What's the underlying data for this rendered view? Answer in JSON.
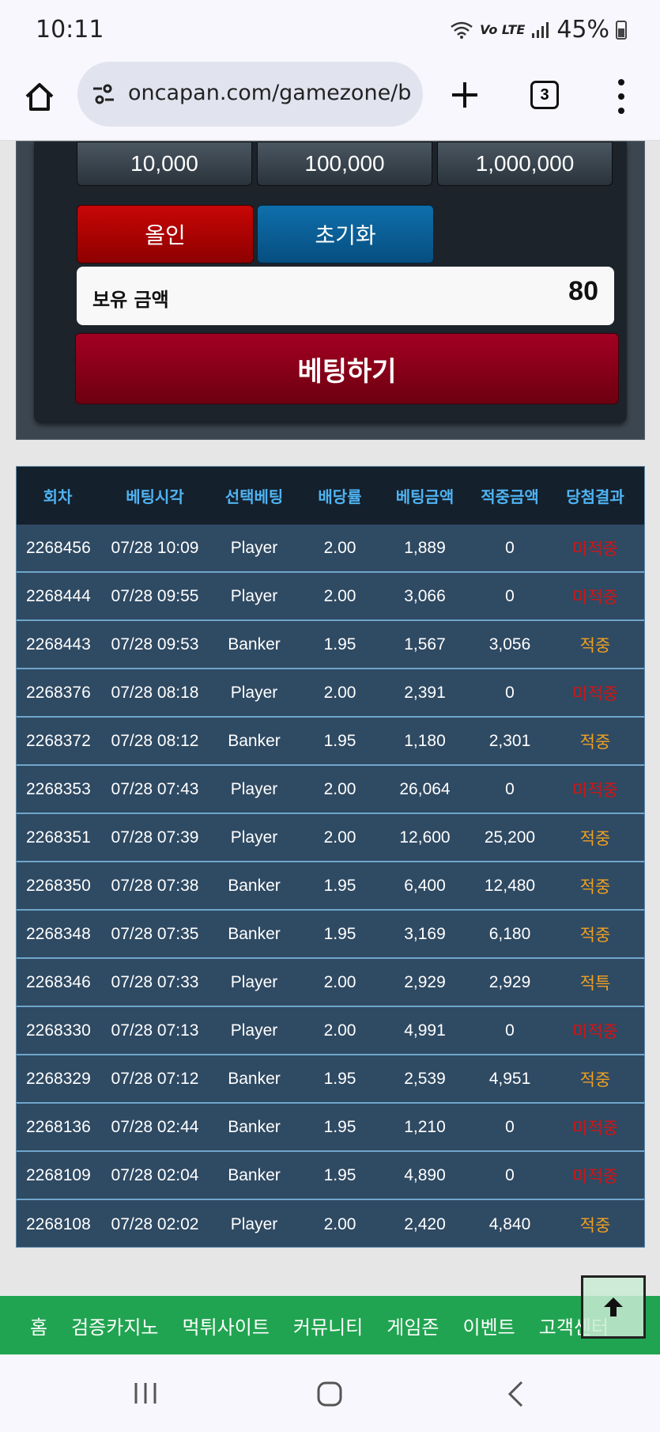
{
  "status_bar": {
    "time": "10:11",
    "network": "Vo LTE",
    "battery": "45%"
  },
  "browser": {
    "url": "oncapan.com/gamezone/b",
    "tab_count": "3"
  },
  "bet_panel": {
    "chips": [
      "10,000",
      "100,000",
      "1,000,000"
    ],
    "all_in_label": "올인",
    "reset_label": "초기화",
    "balance_label": "보유 금액",
    "balance_value": "80",
    "bet_button_label": "베팅하기"
  },
  "history": {
    "headers": [
      "회차",
      "베팅시각",
      "선택베팅",
      "배당률",
      "베팅금액",
      "적중금액",
      "당첨결과"
    ],
    "result_colors": {
      "hit": "#f0a020",
      "miss": "#d01515"
    },
    "rows": [
      {
        "round": "2268456",
        "time": "07/28 10:09",
        "pick": "Player",
        "odds": "2.00",
        "bet": "1,889",
        "win": "0",
        "result": "미적중",
        "status": "miss"
      },
      {
        "round": "2268444",
        "time": "07/28 09:55",
        "pick": "Player",
        "odds": "2.00",
        "bet": "3,066",
        "win": "0",
        "result": "미적중",
        "status": "miss"
      },
      {
        "round": "2268443",
        "time": "07/28 09:53",
        "pick": "Banker",
        "odds": "1.95",
        "bet": "1,567",
        "win": "3,056",
        "result": "적중",
        "status": "hit"
      },
      {
        "round": "2268376",
        "time": "07/28 08:18",
        "pick": "Player",
        "odds": "2.00",
        "bet": "2,391",
        "win": "0",
        "result": "미적중",
        "status": "miss"
      },
      {
        "round": "2268372",
        "time": "07/28 08:12",
        "pick": "Banker",
        "odds": "1.95",
        "bet": "1,180",
        "win": "2,301",
        "result": "적중",
        "status": "hit"
      },
      {
        "round": "2268353",
        "time": "07/28 07:43",
        "pick": "Player",
        "odds": "2.00",
        "bet": "26,064",
        "win": "0",
        "result": "미적중",
        "status": "miss"
      },
      {
        "round": "2268351",
        "time": "07/28 07:39",
        "pick": "Player",
        "odds": "2.00",
        "bet": "12,600",
        "win": "25,200",
        "result": "적중",
        "status": "hit"
      },
      {
        "round": "2268350",
        "time": "07/28 07:38",
        "pick": "Banker",
        "odds": "1.95",
        "bet": "6,400",
        "win": "12,480",
        "result": "적중",
        "status": "hit"
      },
      {
        "round": "2268348",
        "time": "07/28 07:35",
        "pick": "Banker",
        "odds": "1.95",
        "bet": "3,169",
        "win": "6,180",
        "result": "적중",
        "status": "hit"
      },
      {
        "round": "2268346",
        "time": "07/28 07:33",
        "pick": "Player",
        "odds": "2.00",
        "bet": "2,929",
        "win": "2,929",
        "result": "적특",
        "status": "hit"
      },
      {
        "round": "2268330",
        "time": "07/28 07:13",
        "pick": "Player",
        "odds": "2.00",
        "bet": "4,991",
        "win": "0",
        "result": "미적중",
        "status": "miss"
      },
      {
        "round": "2268329",
        "time": "07/28 07:12",
        "pick": "Banker",
        "odds": "1.95",
        "bet": "2,539",
        "win": "4,951",
        "result": "적중",
        "status": "hit"
      },
      {
        "round": "2268136",
        "time": "07/28 02:44",
        "pick": "Banker",
        "odds": "1.95",
        "bet": "1,210",
        "win": "0",
        "result": "미적중",
        "status": "miss"
      },
      {
        "round": "2268109",
        "time": "07/28 02:04",
        "pick": "Banker",
        "odds": "1.95",
        "bet": "4,890",
        "win": "0",
        "result": "미적중",
        "status": "miss"
      },
      {
        "round": "2268108",
        "time": "07/28 02:02",
        "pick": "Player",
        "odds": "2.00",
        "bet": "2,420",
        "win": "4,840",
        "result": "적중",
        "status": "hit"
      }
    ]
  },
  "bottom_nav": [
    "홈",
    "검증카지노",
    "먹튀사이트",
    "커뮤니티",
    "게임존",
    "이벤트",
    "고객센터"
  ],
  "icons": {
    "scroll_top": "arrow-up-icon",
    "system_nav": [
      "recents-icon",
      "home-icon",
      "back-icon"
    ]
  }
}
